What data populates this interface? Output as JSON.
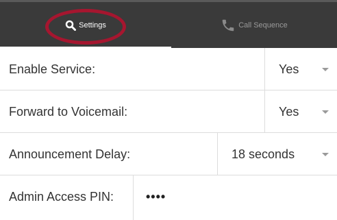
{
  "tabs": {
    "settings_label": "Settings",
    "settings_icon": "search-icon",
    "call_sequence_label": "Call Sequence",
    "call_sequence_icon": "phone-icon"
  },
  "colors": {
    "tabbar_bg": "#3a3a3a",
    "highlight_ring": "#a6162f"
  },
  "rows": [
    {
      "label": "Enable Service:",
      "value": "Yes"
    },
    {
      "label": "Forward to Voicemail:",
      "value": "Yes"
    },
    {
      "label": "Announcement Delay:",
      "value": "18 seconds"
    },
    {
      "label": "Admin Access PIN:",
      "value": "••••"
    }
  ]
}
